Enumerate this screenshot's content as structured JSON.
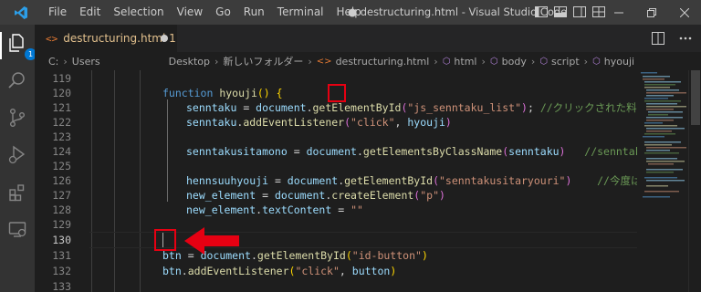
{
  "titlebar": {
    "menu": [
      "File",
      "Edit",
      "Selection",
      "View",
      "Go",
      "Run",
      "Terminal",
      "Help"
    ],
    "window_title": "● destructuring.html - Visual Studio Code"
  },
  "activity": {
    "explorer_badge": "1"
  },
  "tab": {
    "icon": "<>",
    "label": "destructuring.html 1"
  },
  "breadcrumb": {
    "items": [
      "C:",
      "Users",
      "Desktop",
      "新しいフォルダー",
      "destructuring.html",
      "html",
      "body",
      "script",
      "hyouji"
    ]
  },
  "editor": {
    "line_numbers": [
      "119",
      "120",
      "121",
      "122",
      "123",
      "124",
      "125",
      "126",
      "127",
      "128",
      "129",
      "130",
      "131",
      "132",
      "133"
    ],
    "active_line": "130",
    "lines": {
      "l120": {
        "kw": "function",
        "fn": "hyouji",
        "paren": "()",
        "brace": "{"
      },
      "l121": {
        "v1": "senntaku",
        "eq": " = ",
        "v2": "document",
        "dot": ".",
        "fn": "getElementById",
        "p1": "(",
        "str": "\"js_senntaku_list\"",
        "p2": ")",
        "semi": ";",
        "cmt": "//クリックされた料理を"
      },
      "l122": {
        "v1": "senntaku",
        "dot": ".",
        "fn": "addEventListener",
        "p1": "(",
        "str": "\"click\"",
        "comma": ", ",
        "v2": "hyouji",
        "p2": ")"
      },
      "l124": {
        "v1": "senntakusitamono",
        "eq": " = ",
        "v2": "document",
        "dot": ".",
        "fn": "getElementsByClassName",
        "p1": "(",
        "v3": "senntaku",
        "p2": ")",
        "cmt": "//senntakusi"
      },
      "l126": {
        "v1": "hennsuuhyouji",
        "eq": " = ",
        "v2": "document",
        "dot": ".",
        "fn": "getElementById",
        "p1": "(",
        "str": "\"senntakusitaryouri\"",
        "p2": ")",
        "cmt": "//今度はそ"
      },
      "l127": {
        "v1": "new_element",
        "eq": " = ",
        "v2": "document",
        "dot": ".",
        "fn": "createElement",
        "p1": "(",
        "str": "\"p\"",
        "p2": ")"
      },
      "l128": {
        "v1": "new_element",
        "dot": ".",
        "v2": "textContent",
        "eq": " = ",
        "str": "\"\""
      },
      "l131": {
        "v1": "btn",
        "eq": " = ",
        "v2": "document",
        "dot": ".",
        "fn": "getElementById",
        "p1": "(",
        "str": "\"id-button\"",
        "p2": ")"
      },
      "l132": {
        "v1": "btn",
        "dot": ".",
        "fn": "addEventListener",
        "p1": "(",
        "str": "\"click\"",
        "comma": ", ",
        "v2": "button",
        "p2": ")"
      }
    }
  },
  "colors": {
    "annotation_red": "#e60012",
    "background": "#1e1e1e"
  }
}
